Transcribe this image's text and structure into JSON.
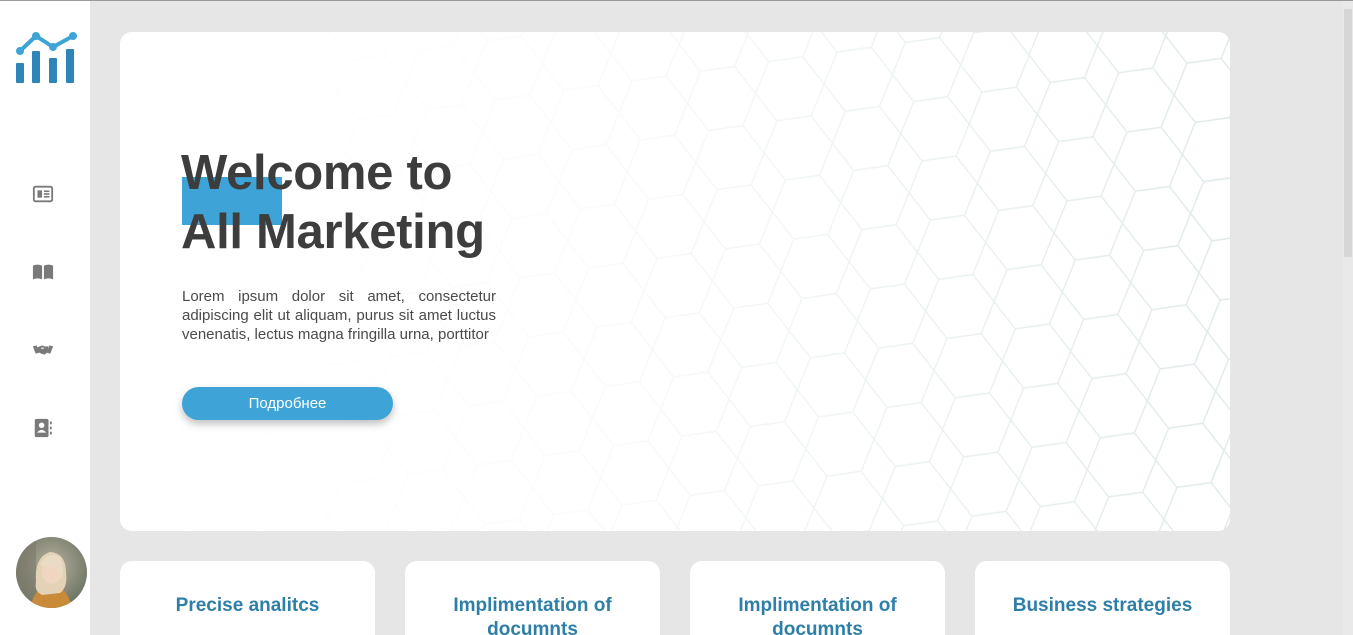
{
  "app": {
    "name": "All Marketing"
  },
  "colors": {
    "accent": "#3ea3d6",
    "heading": "#3d3d3d",
    "card_title": "#2e7fa8",
    "background": "#e6e6e6"
  },
  "sidebar": {
    "logo_icon": "bar-chart-trend-icon",
    "items": [
      {
        "icon": "newspaper-icon"
      },
      {
        "icon": "open-book-icon"
      },
      {
        "icon": "handshake-icon"
      },
      {
        "icon": "contact-book-icon"
      }
    ],
    "avatar": "user-avatar"
  },
  "hero": {
    "title_line1": "Welcome to",
    "title_line2": "All Marketing",
    "description": "Lorem ipsum dolor sit amet, consectetur adipiscing elit ut aliquam, purus sit amet luctus venenatis, lectus magna fringilla urna, porttitor",
    "button_label": "Подробнее"
  },
  "cards": [
    {
      "title": "Precise analitcs"
    },
    {
      "title": "Implimentation of documnts"
    },
    {
      "title": "Implimentation of documnts"
    },
    {
      "title": "Business strategies"
    }
  ]
}
